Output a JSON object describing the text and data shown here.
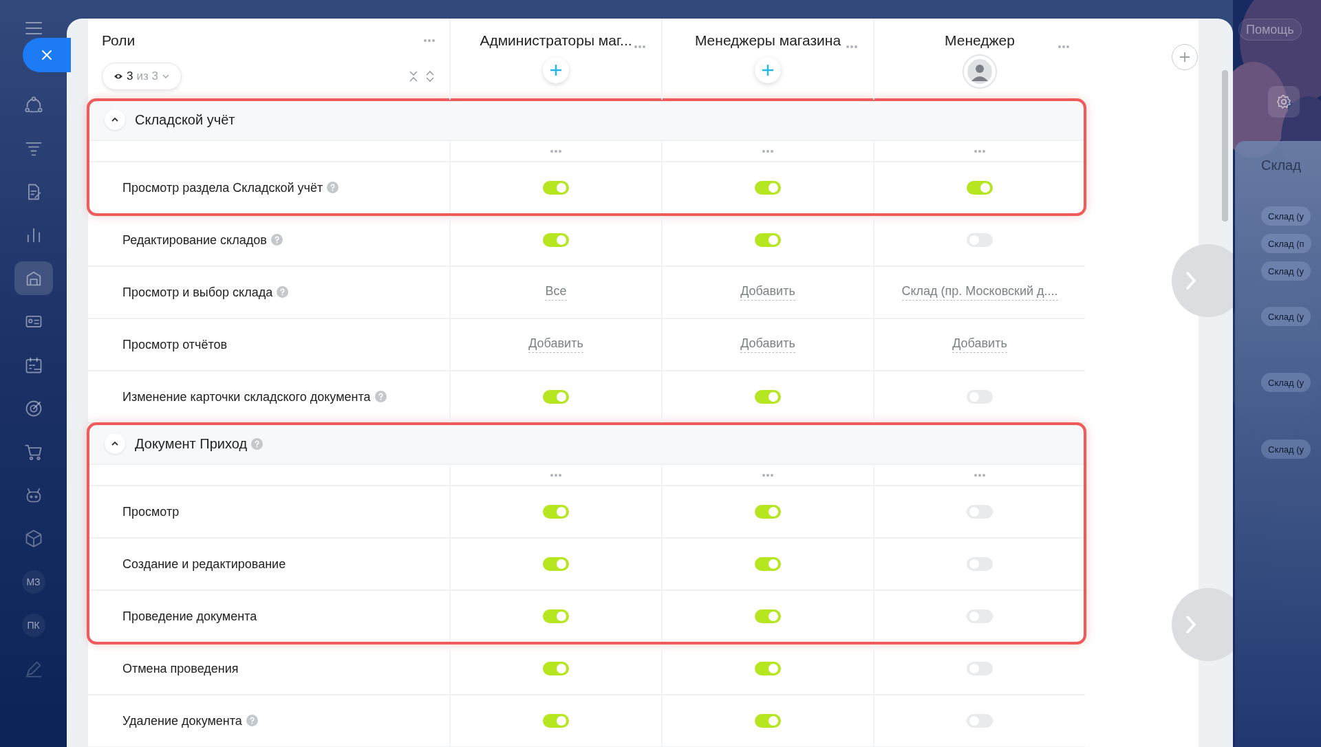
{
  "sidebar": {
    "items": [
      {
        "kind": "flow",
        "selected": false
      },
      {
        "kind": "funnel",
        "selected": false
      },
      {
        "kind": "doc",
        "selected": false
      },
      {
        "kind": "chart",
        "selected": false
      },
      {
        "kind": "store",
        "selected": true
      },
      {
        "kind": "card",
        "selected": false
      },
      {
        "kind": "calendar",
        "selected": false
      },
      {
        "kind": "target",
        "selected": false
      },
      {
        "kind": "cart",
        "selected": false
      },
      {
        "kind": "robot",
        "selected": false
      },
      {
        "kind": "box",
        "selected": false
      },
      {
        "kind": "text",
        "label": "МЗ",
        "selected": false
      },
      {
        "kind": "text",
        "label": "ПК",
        "selected": false
      },
      {
        "kind": "pen",
        "selected": false
      }
    ]
  },
  "roles_header": {
    "title": "Роли",
    "filter_count": "3",
    "filter_total": "из 3"
  },
  "columns": [
    {
      "title": "Администраторы маг...",
      "kind": "add"
    },
    {
      "title": "Менеджеры магазина",
      "kind": "add"
    },
    {
      "title": "Менеджер",
      "kind": "avatar"
    }
  ],
  "sections": [
    {
      "title": "Складской учёт",
      "help": false,
      "expanded": true,
      "highlighted": true,
      "rows": [
        {
          "label": "Просмотр раздела Складской учёт",
          "help": true,
          "highlighted": true,
          "cells": [
            {
              "kind": "toggle",
              "on": true
            },
            {
              "kind": "toggle",
              "on": true
            },
            {
              "kind": "toggle",
              "on": true
            }
          ]
        },
        {
          "label": "Редактирование складов",
          "help": true,
          "highlighted": false,
          "cells": [
            {
              "kind": "toggle",
              "on": true
            },
            {
              "kind": "toggle",
              "on": true
            },
            {
              "kind": "toggle",
              "on": false
            }
          ]
        },
        {
          "label": "Просмотр и выбор склада",
          "help": true,
          "highlighted": false,
          "cells": [
            {
              "kind": "link",
              "text": "Все"
            },
            {
              "kind": "link",
              "text": "Добавить"
            },
            {
              "kind": "link",
              "text": "Склад (пр. Московский д...."
            }
          ]
        },
        {
          "label": "Просмотр отчётов",
          "help": false,
          "highlighted": false,
          "cells": [
            {
              "kind": "link",
              "text": "Добавить"
            },
            {
              "kind": "link",
              "text": "Добавить"
            },
            {
              "kind": "link",
              "text": "Добавить"
            }
          ]
        },
        {
          "label": "Изменение карточки складского документа",
          "help": true,
          "highlighted": false,
          "cells": [
            {
              "kind": "toggle",
              "on": true
            },
            {
              "kind": "toggle",
              "on": true
            },
            {
              "kind": "toggle",
              "on": false
            }
          ]
        }
      ]
    },
    {
      "title": "Документ Приход",
      "help": true,
      "expanded": true,
      "highlighted": true,
      "rows": [
        {
          "label": "Просмотр",
          "help": false,
          "highlighted": true,
          "cells": [
            {
              "kind": "toggle",
              "on": true
            },
            {
              "kind": "toggle",
              "on": true
            },
            {
              "kind": "toggle",
              "on": false
            }
          ]
        },
        {
          "label": "Создание и редактирование",
          "help": false,
          "highlighted": true,
          "cells": [
            {
              "kind": "toggle",
              "on": true
            },
            {
              "kind": "toggle",
              "on": true
            },
            {
              "kind": "toggle",
              "on": false
            }
          ]
        },
        {
          "label": "Проведение документа",
          "help": false,
          "highlighted": true,
          "cells": [
            {
              "kind": "toggle",
              "on": true
            },
            {
              "kind": "toggle",
              "on": true
            },
            {
              "kind": "toggle",
              "on": false
            }
          ]
        },
        {
          "label": "Отмена проведения",
          "help": false,
          "highlighted": false,
          "cells": [
            {
              "kind": "toggle",
              "on": true
            },
            {
              "kind": "toggle",
              "on": true
            },
            {
              "kind": "toggle",
              "on": false
            }
          ]
        },
        {
          "label": "Удаление документа",
          "help": true,
          "highlighted": false,
          "cells": [
            {
              "kind": "toggle",
              "on": true
            },
            {
              "kind": "toggle",
              "on": true
            },
            {
              "kind": "toggle",
              "on": false
            }
          ]
        }
      ]
    }
  ],
  "background": {
    "help_button": "Помощь",
    "panel_title": "Склад",
    "chips": [
      "Склад (у",
      "Склад (п",
      "Склад (у",
      "Склад (у",
      "Склад (у",
      "Склад (у"
    ]
  }
}
